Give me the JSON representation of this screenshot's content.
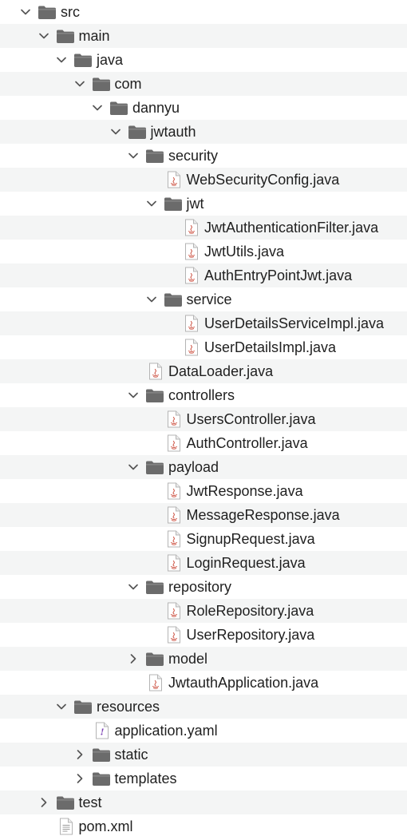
{
  "tree": [
    {
      "label": "src",
      "type": "folder",
      "depth": 0,
      "expanded": true
    },
    {
      "label": "main",
      "type": "folder",
      "depth": 1,
      "expanded": true
    },
    {
      "label": "java",
      "type": "folder",
      "depth": 2,
      "expanded": true
    },
    {
      "label": "com",
      "type": "folder",
      "depth": 3,
      "expanded": true
    },
    {
      "label": "dannyu",
      "type": "folder",
      "depth": 4,
      "expanded": true
    },
    {
      "label": "jwtauth",
      "type": "folder",
      "depth": 5,
      "expanded": true
    },
    {
      "label": "security",
      "type": "folder",
      "depth": 6,
      "expanded": true
    },
    {
      "label": "WebSecurityConfig.java",
      "type": "java",
      "depth": 7
    },
    {
      "label": "jwt",
      "type": "folder",
      "depth": 7,
      "expanded": true
    },
    {
      "label": "JwtAuthenticationFilter.java",
      "type": "java",
      "depth": 8
    },
    {
      "label": "JwtUtils.java",
      "type": "java",
      "depth": 8
    },
    {
      "label": "AuthEntryPointJwt.java",
      "type": "java",
      "depth": 8
    },
    {
      "label": "service",
      "type": "folder",
      "depth": 7,
      "expanded": true
    },
    {
      "label": "UserDetailsServiceImpl.java",
      "type": "java",
      "depth": 8
    },
    {
      "label": "UserDetailsImpl.java",
      "type": "java",
      "depth": 8
    },
    {
      "label": "DataLoader.java",
      "type": "java",
      "depth": 6
    },
    {
      "label": "controllers",
      "type": "folder",
      "depth": 6,
      "expanded": true
    },
    {
      "label": "UsersController.java",
      "type": "java",
      "depth": 7
    },
    {
      "label": "AuthController.java",
      "type": "java",
      "depth": 7
    },
    {
      "label": "payload",
      "type": "folder",
      "depth": 6,
      "expanded": true
    },
    {
      "label": "JwtResponse.java",
      "type": "java",
      "depth": 7
    },
    {
      "label": "MessageResponse.java",
      "type": "java",
      "depth": 7
    },
    {
      "label": "SignupRequest.java",
      "type": "java",
      "depth": 7
    },
    {
      "label": "LoginRequest.java",
      "type": "java",
      "depth": 7
    },
    {
      "label": "repository",
      "type": "folder",
      "depth": 6,
      "expanded": true
    },
    {
      "label": "RoleRepository.java",
      "type": "java",
      "depth": 7
    },
    {
      "label": "UserRepository.java",
      "type": "java",
      "depth": 7
    },
    {
      "label": "model",
      "type": "folder",
      "depth": 6,
      "expanded": false
    },
    {
      "label": "JwtauthApplication.java",
      "type": "java",
      "depth": 6
    },
    {
      "label": "resources",
      "type": "folder",
      "depth": 2,
      "expanded": true
    },
    {
      "label": "application.yaml",
      "type": "yaml",
      "depth": 3
    },
    {
      "label": "static",
      "type": "folder",
      "depth": 3,
      "expanded": false
    },
    {
      "label": "templates",
      "type": "folder",
      "depth": 3,
      "expanded": false
    },
    {
      "label": "test",
      "type": "folder",
      "depth": 1,
      "expanded": false
    },
    {
      "label": "pom.xml",
      "type": "xml",
      "depth": 1
    }
  ],
  "icons": {
    "folder": "folder-icon",
    "java": "java-file-icon",
    "yaml": "yaml-file-icon",
    "xml": "xml-file-icon",
    "expanded": "chevron-down-icon",
    "collapsed": "chevron-right-icon"
  },
  "colors": {
    "folder": "#6b6b6b",
    "stripe": "#f4f5f5",
    "text": "#1f1f1f",
    "java_accent": "#c8402f",
    "yaml_accent": "#7b3fb3"
  }
}
